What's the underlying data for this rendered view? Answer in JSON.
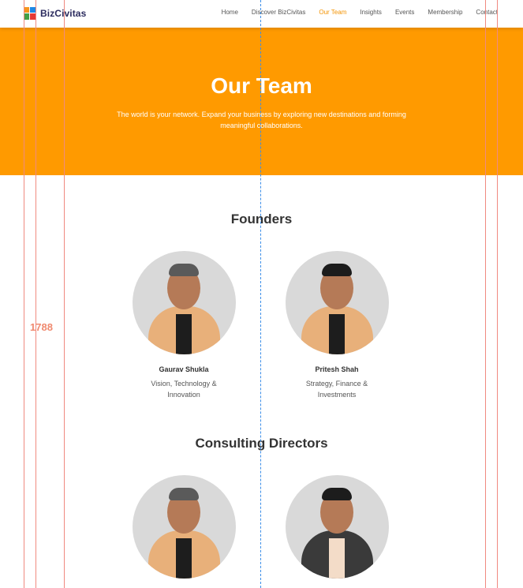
{
  "brand": {
    "name": "BizCivitas"
  },
  "nav": {
    "items": [
      "Home",
      "Discover BizCivitas",
      "Our Team",
      "Insights",
      "Events",
      "Membership",
      "Contact"
    ],
    "active": "Our Team"
  },
  "hero": {
    "title": "Our Team",
    "subtitle": "The world is your network. Expand your business by exploring new destinations and forming meaningful collaborations."
  },
  "founders": {
    "title": "Founders",
    "members": [
      {
        "name": "Gaurav Shukla",
        "role": "Vision, Technology & Innovation"
      },
      {
        "name": "Pritesh Shah",
        "role": "Strategy, Finance & Investments"
      }
    ]
  },
  "directors": {
    "title": "Consulting Directors"
  },
  "overlay": {
    "label": "1788"
  },
  "colors": {
    "accent": "#ff9a00",
    "active_nav": "#f39200",
    "guide": "#f08a80",
    "center_guide": "#3b8ee8"
  }
}
